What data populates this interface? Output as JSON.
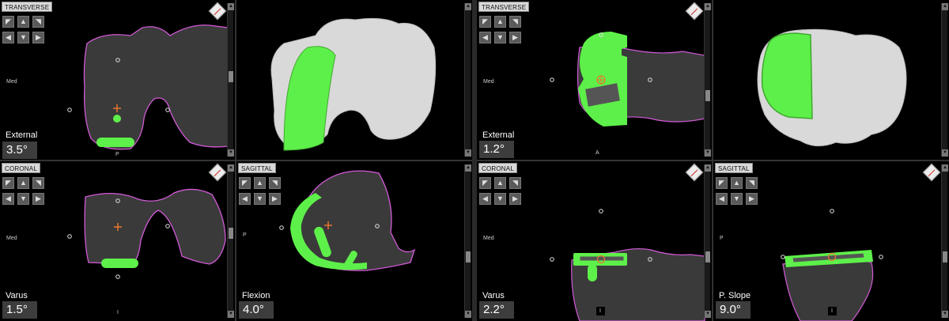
{
  "colors": {
    "implant": "#5ef04a",
    "bone_outline": "#d35ad8",
    "marker": "#e8762e",
    "panel_label_bg": "#d9d9d9",
    "value_bg": "#3d3d3d"
  },
  "control_icons": [
    "arrow-up-left-icon",
    "arrow-up-icon",
    "arrow-up-right-icon",
    "arrow-left-icon",
    "arrow-down-icon",
    "arrow-right-icon"
  ],
  "femur": {
    "transverse": {
      "title": "TRANSVERSE",
      "side": "Med",
      "dir": "P",
      "metric_label": "External",
      "metric_value": "3.5°"
    },
    "model3d": {},
    "coronal": {
      "title": "CORONAL",
      "side": "Med",
      "dir": "I",
      "metric_label": "Varus",
      "metric_value": "1.5°"
    },
    "sagittal": {
      "title": "SAGITTAL",
      "side": "P",
      "metric_label": "Flexion",
      "metric_value": "4.0°"
    }
  },
  "tibia": {
    "transverse": {
      "title": "TRANSVERSE",
      "side": "Med",
      "dir": "A",
      "metric_label": "External",
      "metric_value": "1.2°"
    },
    "model3d": {},
    "coronal": {
      "title": "CORONAL",
      "side": "Med",
      "dir": "I",
      "metric_label": "Varus",
      "metric_value": "2.2°"
    },
    "sagittal": {
      "title": "SAGITTAL",
      "side": "P",
      "dir": "I",
      "metric_label": "P. Slope",
      "metric_value": "9.0°"
    }
  }
}
